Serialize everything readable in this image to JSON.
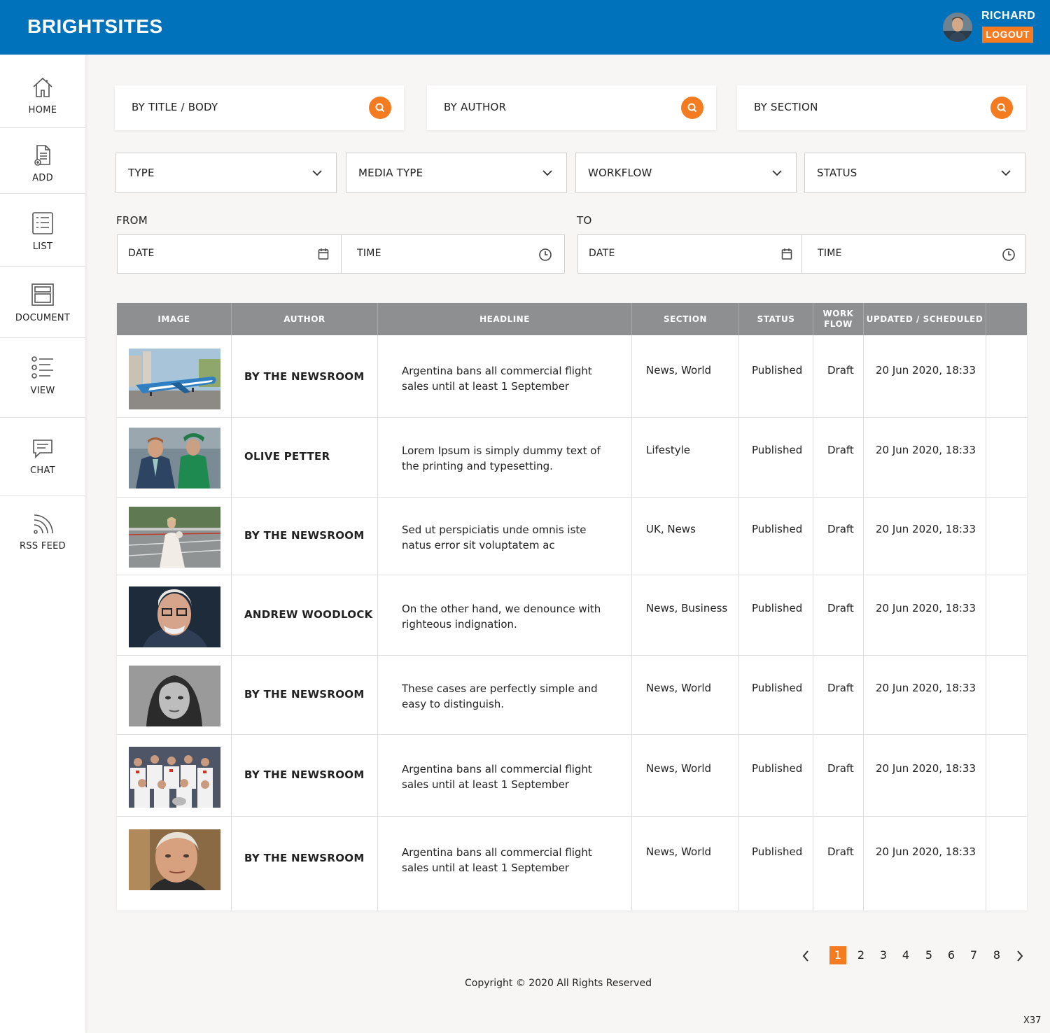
{
  "header": {
    "brand": "BRIGHTSITES",
    "user_name": "RICHARD",
    "logout_label": "LOGOUT"
  },
  "sidebar": {
    "items": [
      {
        "label": "HOME",
        "icon": "home-icon"
      },
      {
        "label": "ADD",
        "icon": "add-document-icon"
      },
      {
        "label": "LIST",
        "icon": "list-icon"
      },
      {
        "label": "DOCUMENT",
        "icon": "document-icon"
      },
      {
        "label": "VIEW",
        "icon": "view-list-icon"
      },
      {
        "label": "CHAT",
        "icon": "chat-icon"
      },
      {
        "label": "RSS FEED",
        "icon": "rss-icon"
      }
    ]
  },
  "search": {
    "title_body": "BY TITLE / BODY",
    "author": "BY AUTHOR",
    "section": "BY SECTION",
    "icon": "search-icon"
  },
  "filters": {
    "type": "TYPE",
    "media_type": "MEDIA TYPE",
    "workflow": "WORKFLOW",
    "status": "STATUS"
  },
  "range": {
    "from_label": "FROM",
    "to_label": "TO",
    "date_placeholder": "DATE",
    "time_placeholder": "TIME"
  },
  "table": {
    "columns": {
      "image": "IMAGE",
      "author": "AUTHOR",
      "headline": "HEADLINE",
      "section": "SECTION",
      "status": "STATUS",
      "workflow_line1": "WORK",
      "workflow_line2": "FLOW",
      "updated": "UPDATED / SCHEDULED"
    },
    "rows": [
      {
        "author": "BY THE NEWSROOM",
        "headline": "Argentina bans all commercial flight sales until at least 1 September",
        "section": "News, World",
        "status": "Published",
        "workflow": "Draft",
        "updated": "20 Jun 2020, 18:33"
      },
      {
        "author": "OLIVE PETTER",
        "headline": "Lorem Ipsum is simply dummy text of the printing and typesetting.",
        "section": "Lifestyle",
        "status": "Published",
        "workflow": "Draft",
        "updated": "20 Jun 2020, 18:33"
      },
      {
        "author": "BY THE NEWSROOM",
        "headline": "Sed ut perspiciatis unde omnis iste natus error sit voluptatem ac",
        "section": "UK, News",
        "status": "Published",
        "workflow": "Draft",
        "updated": "20 Jun 2020, 18:33"
      },
      {
        "author": "ANDREW WOODLOCK",
        "headline": "On the other hand, we denounce with righteous indignation.",
        "section": "News, Business",
        "status": "Published",
        "workflow": "Draft",
        "updated": "20 Jun 2020, 18:33"
      },
      {
        "author": "BY THE NEWSROOM",
        "headline": "These cases are perfectly simple and easy to distinguish.",
        "section": "News, World",
        "status": "Published",
        "workflow": "Draft",
        "updated": "20 Jun 2020, 18:33"
      },
      {
        "author": "BY THE NEWSROOM",
        "headline": "Argentina bans all commercial flight sales until at least 1 September",
        "section": "News, World",
        "status": "Published",
        "workflow": "Draft",
        "updated": "20 Jun 2020, 18:33"
      },
      {
        "author": "BY THE NEWSROOM",
        "headline": "Argentina bans all commercial flight sales until at least 1 September",
        "section": "News, World",
        "status": "Published",
        "workflow": "Draft",
        "updated": "20 Jun 2020, 18:33"
      }
    ]
  },
  "pagination": {
    "pages": [
      "1",
      "2",
      "3",
      "4",
      "5",
      "6",
      "7",
      "8"
    ],
    "current": "1"
  },
  "footer": {
    "copyright": "Copyright © 2020 All Rights Reserved",
    "corner": "X37"
  },
  "colors": {
    "header_bg": "#0072bc",
    "accent": "#f47b20",
    "table_head": "#8e8f91"
  }
}
